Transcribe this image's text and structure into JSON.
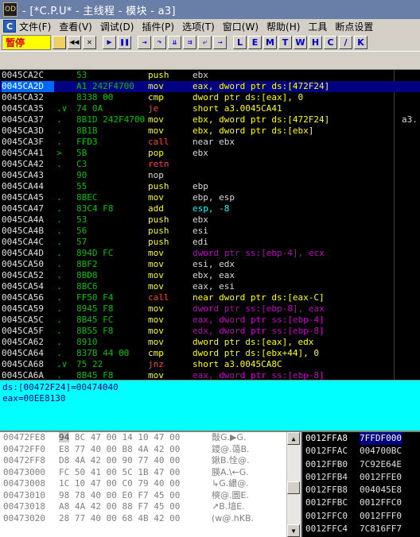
{
  "titlebar": {
    "icon_text": "OD",
    "title": "- [*C.P.U* - 主线程 - 模块 - a3]"
  },
  "menubar": {
    "icon_text": "C",
    "items": [
      "文件(F)",
      "查看(V)",
      "调试(D)",
      "插件(P)",
      "选项(T)",
      "窗口(W)",
      "帮助(H)",
      "工具",
      "断点设置"
    ]
  },
  "toolbar": {
    "status": "暂停",
    "letters": [
      "L",
      "E",
      "M",
      "T",
      "W",
      "H",
      "C",
      "/",
      "K"
    ]
  },
  "colors": {
    "disasm_bg": "#000000",
    "selected_row": "#000080",
    "selected_addr": "#0066ff",
    "hex_bytes": "#00c000",
    "info_bg": "#00ffff",
    "info_text": "#000080",
    "mnemonic_default": "#ffff00",
    "mnemonic_call": "#ff4040",
    "mnemonic_jump": "#ffff00",
    "operand_mem": "#c000c0",
    "dump_bg": "#ffffff",
    "stack_bg": "#000000"
  },
  "disasm": {
    "rows": [
      {
        "addr": "0045CA2C",
        "mark": "",
        "hex": "53",
        "mn": "push",
        "op": "ebx",
        "cm": "",
        "mnc": "#ffff00",
        "opc": "#d8d8d8",
        "sel": false
      },
      {
        "addr": "0045CA2D",
        "mark": "",
        "hex": "A1 242F4700",
        "mn": "mov",
        "op": "eax, dword ptr ds:[472F24]",
        "cm": "",
        "mnc": "#ffff00",
        "opc": "#ffff00",
        "sel": true
      },
      {
        "addr": "0045CA32",
        "mark": "",
        "hex": "8338 00",
        "mn": "cmp",
        "op": "dword ptr ds:[eax], 0",
        "cm": "",
        "mnc": "#ffff00",
        "opc": "#ffff00",
        "sel": false
      },
      {
        "addr": "0045CA35",
        "mark": ".∨",
        "hex": "74 0A",
        "mn": "je",
        "op": "short a3.0045CA41",
        "cm": "",
        "mnc": "#ff4040",
        "opc": "#ffff00",
        "sel": false
      },
      {
        "addr": "0045CA37",
        "mark": ".",
        "hex": "8B1D 242F4700",
        "mn": "mov",
        "op": "ebx, dword ptr ds:[472F24]",
        "cm": "a3.",
        "mnc": "#ffff00",
        "opc": "#ffff00",
        "sel": false
      },
      {
        "addr": "0045CA3D",
        "mark": ".",
        "hex": "8B1B",
        "mn": "mov",
        "op": "ebx, dword ptr ds:[ebx]",
        "cm": "",
        "mnc": "#ffff00",
        "opc": "#ffff00",
        "sel": false
      },
      {
        "addr": "0045CA3F",
        "mark": ".",
        "hex": "FFD3",
        "mn": "call",
        "op": "near ebx",
        "cm": "",
        "mnc": "#ff4040",
        "opc": "#d8d8d8",
        "sel": false
      },
      {
        "addr": "0045CA41",
        "mark": ">",
        "hex": "5B",
        "mn": "pop",
        "op": "ebx",
        "cm": "",
        "mnc": "#ffff00",
        "opc": "#d8d8d8",
        "sel": false
      },
      {
        "addr": "0045CA42",
        "mark": ".",
        "hex": "C3",
        "mn": "retn",
        "op": "",
        "cm": "",
        "mnc": "#ff4040",
        "opc": "#d8d8d8",
        "sel": false
      },
      {
        "addr": "0045CA43",
        "mark": "",
        "hex": "90",
        "mn": "nop",
        "op": "",
        "cm": "",
        "mnc": "#d8d8d8",
        "opc": "#d8d8d8",
        "sel": false
      },
      {
        "addr": "0045CA44",
        "mark": "",
        "hex": "55",
        "mn": "push",
        "op": "ebp",
        "cm": "",
        "mnc": "#ffff00",
        "opc": "#d8d8d8",
        "sel": false
      },
      {
        "addr": "0045CA45",
        "mark": ".",
        "hex": "8BEC",
        "mn": "mov",
        "op": "ebp, esp",
        "cm": "",
        "mnc": "#ffff00",
        "opc": "#d8d8d8",
        "sel": false
      },
      {
        "addr": "0045CA47",
        "mark": ".",
        "hex": "83C4 F8",
        "mn": "add",
        "op": "esp, -8",
        "cm": "",
        "mnc": "#ffff00",
        "opc": "#00ffff",
        "sel": false
      },
      {
        "addr": "0045CA4A",
        "mark": ".",
        "hex": "53",
        "mn": "push",
        "op": "ebx",
        "cm": "",
        "mnc": "#ffff00",
        "opc": "#d8d8d8",
        "sel": false
      },
      {
        "addr": "0045CA4B",
        "mark": ".",
        "hex": "56",
        "mn": "push",
        "op": "esi",
        "cm": "",
        "mnc": "#ffff00",
        "opc": "#d8d8d8",
        "sel": false
      },
      {
        "addr": "0045CA4C",
        "mark": ".",
        "hex": "57",
        "mn": "push",
        "op": "edi",
        "cm": "",
        "mnc": "#ffff00",
        "opc": "#d8d8d8",
        "sel": false
      },
      {
        "addr": "0045CA4D",
        "mark": ".",
        "hex": "894D FC",
        "mn": "mov",
        "op": "dword ptr ss:[ebp-4], ecx",
        "cm": "",
        "mnc": "#ffff00",
        "opc": "#c000c0",
        "sel": false
      },
      {
        "addr": "0045CA50",
        "mark": ".",
        "hex": "8BF2",
        "mn": "mov",
        "op": "esi, edx",
        "cm": "",
        "mnc": "#ffff00",
        "opc": "#d8d8d8",
        "sel": false
      },
      {
        "addr": "0045CA52",
        "mark": ".",
        "hex": "8BD8",
        "mn": "mov",
        "op": "ebx, eax",
        "cm": "",
        "mnc": "#ffff00",
        "opc": "#d8d8d8",
        "sel": false
      },
      {
        "addr": "0045CA54",
        "mark": ".",
        "hex": "8BC6",
        "mn": "mov",
        "op": "eax, esi",
        "cm": "",
        "mnc": "#ffff00",
        "opc": "#d8d8d8",
        "sel": false
      },
      {
        "addr": "0045CA56",
        "mark": ".",
        "hex": "FF50 F4",
        "mn": "call",
        "op": "near dword ptr ds:[eax-C]",
        "cm": "",
        "mnc": "#ff4040",
        "opc": "#ffff00",
        "sel": false
      },
      {
        "addr": "0045CA59",
        "mark": ".",
        "hex": "8945 F8",
        "mn": "mov",
        "op": "dword ptr ss:[ebp-8], eax",
        "cm": "",
        "mnc": "#ffff00",
        "opc": "#c000c0",
        "sel": false
      },
      {
        "addr": "0045CA5C",
        "mark": ".",
        "hex": "8B45 FC",
        "mn": "mov",
        "op": "eax, dword ptr ss:[ebp-4]",
        "cm": "",
        "mnc": "#ffff00",
        "opc": "#c000c0",
        "sel": false
      },
      {
        "addr": "0045CA5F",
        "mark": ".",
        "hex": "8B55 F8",
        "mn": "mov",
        "op": "edx, dword ptr ss:[ebp-8]",
        "cm": "",
        "mnc": "#ffff00",
        "opc": "#c000c0",
        "sel": false
      },
      {
        "addr": "0045CA62",
        "mark": ".",
        "hex": "8910",
        "mn": "mov",
        "op": "dword ptr ds:[eax], edx",
        "cm": "",
        "mnc": "#ffff00",
        "opc": "#ffff00",
        "sel": false
      },
      {
        "addr": "0045CA64",
        "mark": ".",
        "hex": "837B 44 00",
        "mn": "cmp",
        "op": "dword ptr ds:[ebx+44], 0",
        "cm": "",
        "mnc": "#ffff00",
        "opc": "#ffff00",
        "sel": false
      },
      {
        "addr": "0045CA68",
        "mark": ".∨",
        "hex": "75 22",
        "mn": "jnz",
        "op": "short a3.0045CA8C",
        "cm": "",
        "mnc": "#ff4040",
        "opc": "#ffff00",
        "sel": false
      },
      {
        "addr": "0045CA6A",
        "mark": ".",
        "hex": "8B45 F8",
        "mn": "mov",
        "op": "eax, dword ptr ss:[ebp-8]",
        "cm": "",
        "mnc": "#ffff00",
        "opc": "#c000c0",
        "sel": false
      }
    ]
  },
  "info": {
    "line1": "ds:[00472F24]=00474040",
    "line2": "eax=00EE8130"
  },
  "dump": {
    "rows": [
      {
        "addr": "00472FE8",
        "first": "94",
        "rest": " 8C 47 00 14 10 47 00",
        "ascii": "敽G.▶G."
      },
      {
        "addr": "00472FF0",
        "first": "E8",
        "rest": " 77 40 00 B8 4A 42 00",
        "ascii": "鑁@.蔼B."
      },
      {
        "addr": "00472FF8",
        "first": "D8",
        "rest": " 4A 42 00 90 77 40 00",
        "ascii": "鍬B.恮@."
      },
      {
        "addr": "00473000",
        "first": "FC",
        "rest": " 50 41 00 5C 1B 47 00",
        "ascii": "朠A.\\←G."
      },
      {
        "addr": "00473008",
        "first": "1C",
        "rest": " 10 47 00 C0 79 40 00",
        "ascii": "↳G.繷@."
      },
      {
        "addr": "00473010",
        "first": "98",
        "rest": " 78 40 00 E0 F7 45 00",
        "ascii": "樉@.圜E."
      },
      {
        "addr": "00473018",
        "first": "A8",
        "rest": " 4A 42 00 88 F7 45 00",
        "ascii": "↗B.堷E."
      },
      {
        "addr": "00473020",
        "first": "28",
        "rest": " 77 40 00 68 4B 42 00",
        "ascii": "(w@.hKB."
      }
    ]
  },
  "stack": {
    "rows": [
      {
        "addr": "0012FFA8",
        "val": "7FFDF000",
        "sel": true
      },
      {
        "addr": "0012FFAC",
        "val": "004700BC",
        "sel": false
      },
      {
        "addr": "0012FFB0",
        "val": "7C92E64E",
        "sel": false
      },
      {
        "addr": "0012FFB4",
        "val": "0012FFE0",
        "sel": false
      },
      {
        "addr": "0012FFB8",
        "val": "004045E8",
        "sel": false
      },
      {
        "addr": "0012FFBC",
        "val": "0012FFC0",
        "sel": false
      },
      {
        "addr": "0012FFC0",
        "val": "0012FFF0",
        "sel": false
      },
      {
        "addr": "0012FFC4",
        "val": "7C816FF7",
        "sel": false
      }
    ]
  }
}
